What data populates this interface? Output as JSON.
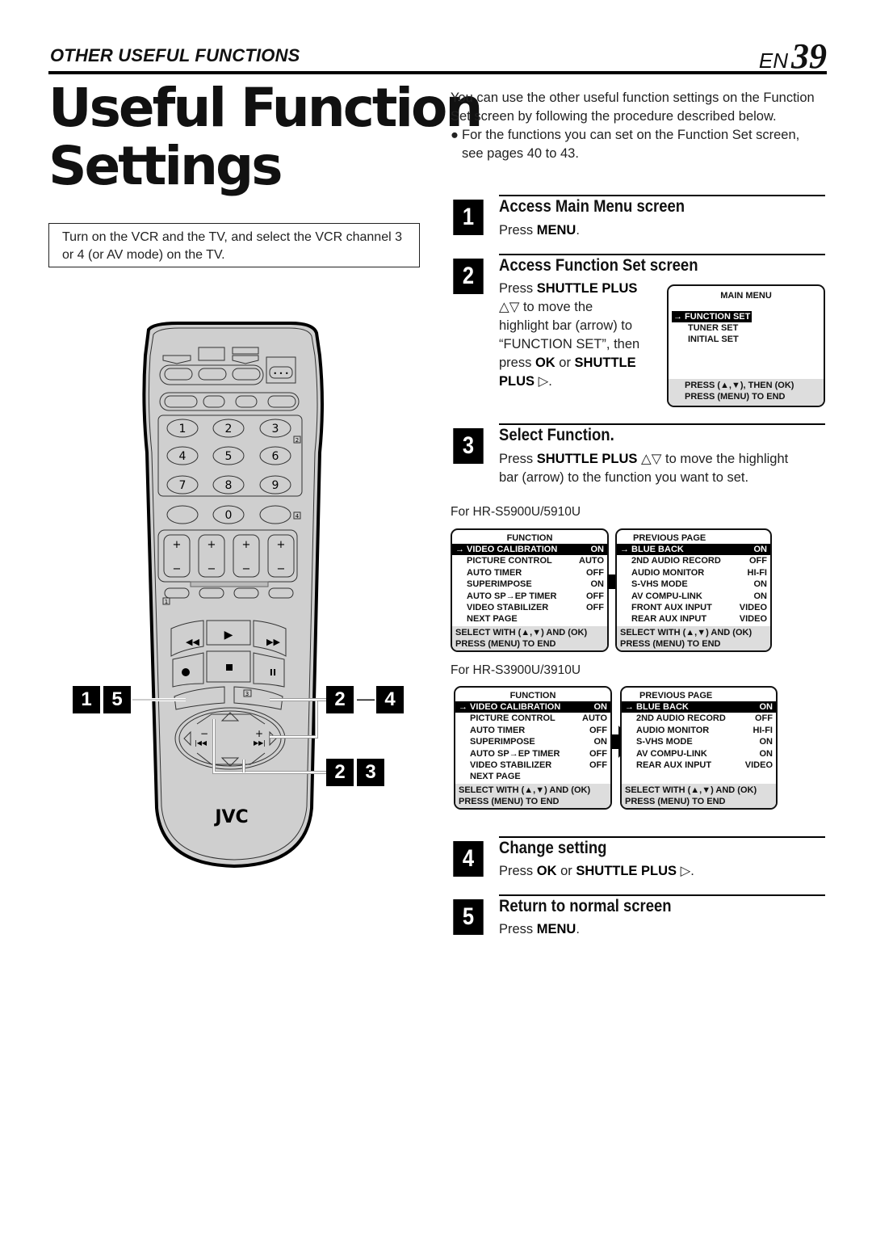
{
  "header": {
    "section_title": "OTHER USEFUL FUNCTIONS",
    "page_prefix": "EN",
    "page_number": "39"
  },
  "title": {
    "line1": "Useful Function",
    "line2": "Settings"
  },
  "note": "Turn on the VCR and the TV, and select the VCR channel 3 or 4 (or AV mode) on the TV.",
  "intro": {
    "text": "You can use the other useful function settings on the Function Set screen by following the procedure described below.",
    "bullet": "For the functions you can set on the Function Set screen, see pages 40 to 43."
  },
  "steps": [
    {
      "num": "1",
      "title": "Access Main Menu screen",
      "body_pre": "Press ",
      "body_bold": "MENU",
      "body_post": "."
    },
    {
      "num": "2",
      "title": "Access Function Set screen",
      "line1_pre": "Press ",
      "line1_bold": "SHUTTLE PLUS",
      "line2": "△▽ to move the",
      "line3": "highlight bar (arrow) to",
      "line4": "“FUNCTION SET”, then",
      "line5_pre": "press ",
      "line5_bold1": "OK",
      "line5_mid": " or ",
      "line5_bold2": "SHUTTLE",
      "line6_bold": "PLUS",
      "line6_post": " ▷."
    },
    {
      "num": "3",
      "title": "Select Function.",
      "line1_pre": "Press ",
      "line1_bold": "SHUTTLE PLUS",
      "line1_post": " △▽ to move the highlight",
      "line2": "bar (arrow) to the function you want to set."
    },
    {
      "num": "4",
      "title": "Change setting",
      "body_pre": "Press ",
      "body_bold1": "OK",
      "body_mid": " or ",
      "body_bold2": "SHUTTLE PLUS",
      "body_post": " ▷."
    },
    {
      "num": "5",
      "title": "Return to normal screen",
      "body_pre": "Press ",
      "body_bold": "MENU",
      "body_post": "."
    }
  ],
  "main_menu_osd": {
    "title": "MAIN MENU",
    "items": [
      {
        "label": "→ FUNCTION SET",
        "selected": true
      },
      {
        "label": "TUNER SET",
        "selected": false
      },
      {
        "label": "INITIAL SET",
        "selected": false
      }
    ],
    "footer1": "PRESS (▲,▼), THEN (OK)",
    "footer2": "PRESS (MENU) TO END"
  },
  "models": [
    {
      "label": "For HR-S5900U/5910U",
      "page1": {
        "title": "FUNCTION",
        "rows": [
          {
            "label": "→ VIDEO CALIBRATION",
            "value": "ON"
          },
          {
            "label": "PICTURE CONTROL",
            "value": "AUTO"
          },
          {
            "label": "AUTO TIMER",
            "value": "OFF"
          },
          {
            "label": "SUPERIMPOSE",
            "value": "ON"
          },
          {
            "label": "AUTO SP→EP TIMER",
            "value": "OFF"
          },
          {
            "label": "VIDEO STABILIZER",
            "value": "OFF"
          },
          {
            "label": "NEXT PAGE",
            "value": ""
          }
        ],
        "footer1": "SELECT WITH (▲,▼) AND (OK)",
        "footer2": "PRESS (MENU) TO END"
      },
      "page2": {
        "title": "PREVIOUS PAGE",
        "rows": [
          {
            "label": "→ BLUE BACK",
            "value": "ON"
          },
          {
            "label": "2ND AUDIO RECORD",
            "value": "OFF"
          },
          {
            "label": "AUDIO MONITOR",
            "value": "HI-FI"
          },
          {
            "label": "S-VHS MODE",
            "value": "ON"
          },
          {
            "label": "AV COMPU-LINK",
            "value": "ON"
          },
          {
            "label": "FRONT AUX INPUT",
            "value": "VIDEO"
          },
          {
            "label": "REAR AUX INPUT",
            "value": "VIDEO"
          }
        ],
        "footer1": "SELECT WITH (▲,▼) AND (OK)",
        "footer2": "PRESS (MENU) TO END"
      }
    },
    {
      "label": "For HR-S3900U/3910U",
      "page1": {
        "title": "FUNCTION",
        "rows": [
          {
            "label": "→ VIDEO CALIBRATION",
            "value": "ON"
          },
          {
            "label": "PICTURE CONTROL",
            "value": "AUTO"
          },
          {
            "label": "AUTO TIMER",
            "value": "OFF"
          },
          {
            "label": "SUPERIMPOSE",
            "value": "ON"
          },
          {
            "label": "AUTO SP→EP TIMER",
            "value": "OFF"
          },
          {
            "label": "VIDEO STABILIZER",
            "value": "OFF"
          },
          {
            "label": "NEXT PAGE",
            "value": ""
          }
        ],
        "footer1": "SELECT WITH (▲,▼) AND (OK)",
        "footer2": "PRESS (MENU) TO END"
      },
      "page2": {
        "title": "PREVIOUS PAGE",
        "rows": [
          {
            "label": "→ BLUE BACK",
            "value": "ON"
          },
          {
            "label": "2ND AUDIO RECORD",
            "value": "OFF"
          },
          {
            "label": "AUDIO MONITOR",
            "value": "HI-FI"
          },
          {
            "label": "S-VHS MODE",
            "value": "ON"
          },
          {
            "label": "AV COMPU-LINK",
            "value": "ON"
          },
          {
            "label": "REAR AUX INPUT",
            "value": "VIDEO"
          }
        ],
        "footer1": "SELECT WITH (▲,▼) AND (OK)",
        "footer2": "PRESS (MENU) TO END"
      }
    }
  ],
  "remote": {
    "brand": "JVC",
    "number_keys": [
      "1",
      "2",
      "3",
      "4",
      "5",
      "6",
      "7",
      "8",
      "9",
      "0"
    ],
    "box_refs": [
      "2",
      "4",
      "1",
      "3"
    ],
    "callouts": {
      "menu": [
        "1",
        "5"
      ],
      "ok_range_start": "2",
      "ok_range_dash": "—",
      "ok_range_end": "4",
      "shuttle": [
        "2",
        "3"
      ]
    },
    "transport_icons": [
      "rewind-icon",
      "play-icon",
      "fast-forward-icon",
      "record-icon",
      "stop-icon",
      "pause-icon"
    ]
  }
}
